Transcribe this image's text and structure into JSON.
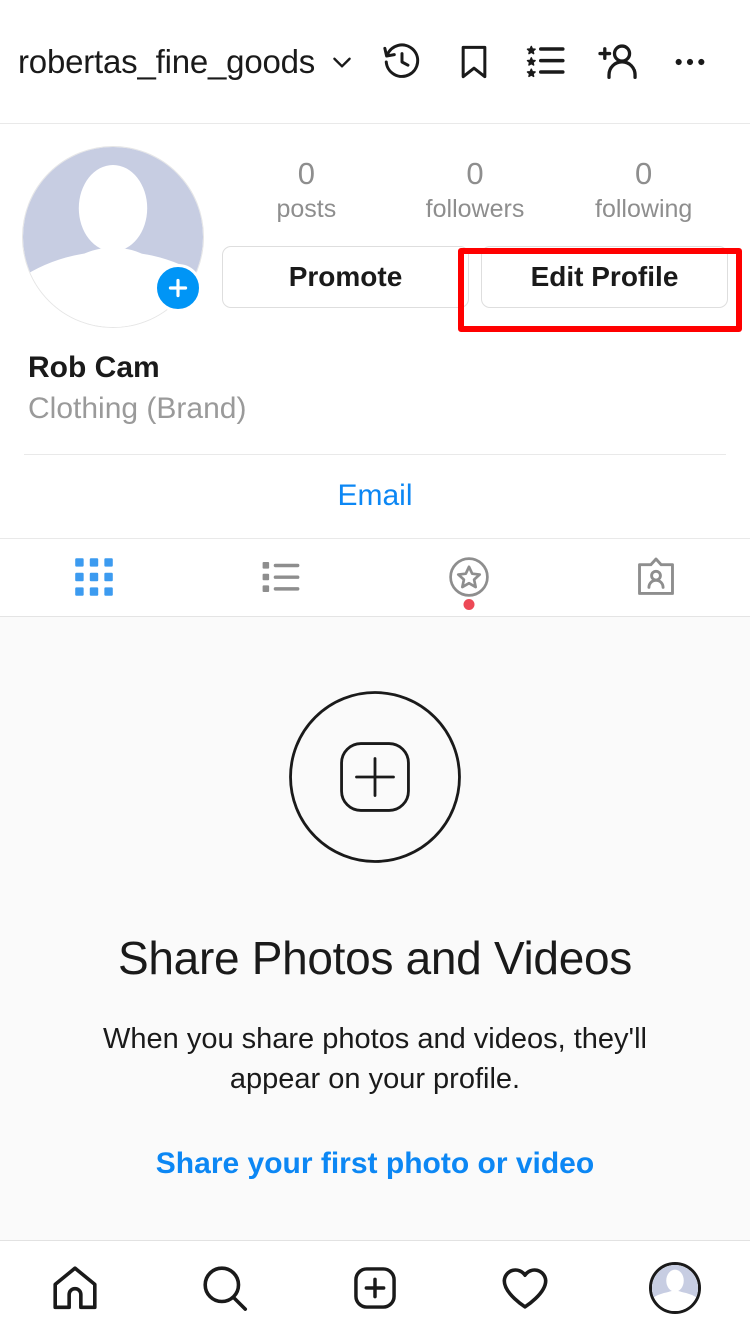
{
  "topbar": {
    "username": "robertas_fine_goods",
    "chevron_icon": "chevron-down-icon",
    "icons": [
      {
        "name": "archive-history-icon",
        "label": "Archive"
      },
      {
        "name": "bookmark-icon",
        "label": "Saved"
      },
      {
        "name": "star-list-icon",
        "label": "Close Friends"
      },
      {
        "name": "add-person-icon",
        "label": "Discover People"
      },
      {
        "name": "more-options-icon",
        "label": "More"
      }
    ]
  },
  "profile": {
    "avatar_icon": "default-avatar-icon",
    "avatar_add_badge_icon": "plus-icon",
    "stats": [
      {
        "value": "0",
        "label": "posts"
      },
      {
        "value": "0",
        "label": "followers"
      },
      {
        "value": "0",
        "label": "following"
      }
    ],
    "buttons": [
      {
        "label": "Promote",
        "name": "promote-button",
        "highlighted": false
      },
      {
        "label": "Edit Profile",
        "name": "edit-profile-button",
        "highlighted": true
      }
    ],
    "display_name": "Rob Cam",
    "category": "Clothing (Brand)",
    "email_label": "Email"
  },
  "tabs": [
    {
      "name": "tab-grid",
      "icon": "grid-icon",
      "active": true,
      "badge": false
    },
    {
      "name": "tab-list",
      "icon": "list-icon",
      "active": false,
      "badge": false
    },
    {
      "name": "tab-highlights",
      "icon": "star-circle-icon",
      "active": false,
      "badge": true
    },
    {
      "name": "tab-tagged",
      "icon": "tagged-card-icon",
      "active": false,
      "badge": false
    }
  ],
  "empty_state": {
    "icon": "add-photo-circle-icon",
    "title": "Share Photos and Videos",
    "subtitle": "When you share photos and videos, they'll appear on your profile.",
    "cta": "Share your first photo or video"
  },
  "bottom_nav": [
    {
      "name": "nav-home",
      "icon": "home-icon",
      "active": false
    },
    {
      "name": "nav-search",
      "icon": "search-icon",
      "active": false
    },
    {
      "name": "nav-create",
      "icon": "plus-square-icon",
      "active": false
    },
    {
      "name": "nav-activity",
      "icon": "heart-icon",
      "active": false
    },
    {
      "name": "nav-profile",
      "icon": "profile-avatar-icon",
      "active": true
    }
  ],
  "colors": {
    "accent_blue": "#0095f6",
    "link_blue": "#0c87f4",
    "muted_gray": "#8e8e8e",
    "badge_red": "#ed4956",
    "highlight_red": "#ff0000",
    "content_bg": "#fafafa"
  }
}
